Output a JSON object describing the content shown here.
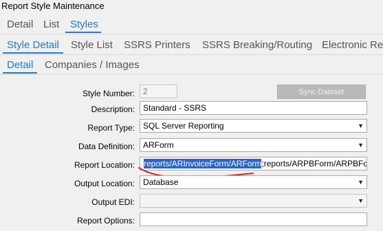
{
  "window": {
    "title": "Report Style Maintenance"
  },
  "tabs_level1": [
    {
      "label": "Detail",
      "active": false
    },
    {
      "label": "List",
      "active": false
    },
    {
      "label": "Styles",
      "active": true
    }
  ],
  "tabs_level2": [
    {
      "label": "Style Detail",
      "active": true
    },
    {
      "label": "Style List",
      "active": false
    },
    {
      "label": "SSRS Printers",
      "active": false
    },
    {
      "label": "SSRS Breaking/Routing",
      "active": false
    },
    {
      "label": "Electronic Re",
      "active": false
    }
  ],
  "tabs_level3": [
    {
      "label": "Detail",
      "active": true
    },
    {
      "label": "Companies / Images",
      "active": false
    }
  ],
  "form": {
    "style_number": {
      "label": "Style Number:",
      "value": "2"
    },
    "sync_button": {
      "label": "Sync Dataset"
    },
    "description": {
      "label": "Description:",
      "value": "Standard - SSRS"
    },
    "report_type": {
      "label": "Report Type:",
      "value": "SQL Server Reporting"
    },
    "data_definition": {
      "label": "Data Definition:",
      "value": "ARForm"
    },
    "report_location": {
      "label": "Report Location:",
      "value_selected": "reports/ARInvoiceForm/ARForm",
      "value_rest": ";reports/ARPBForm/ARPBForm"
    },
    "output_location": {
      "label": "Output Location:",
      "value": "Database"
    },
    "output_edi": {
      "label": "Output EDI:",
      "value": ""
    },
    "report_options": {
      "label": "Report Options:",
      "value": ""
    }
  },
  "colors": {
    "accent": "#1e7bd6",
    "selection": "#2a63c9",
    "annotation": "#e02020"
  },
  "icons": {
    "dropdown": "chevron-down-icon"
  }
}
